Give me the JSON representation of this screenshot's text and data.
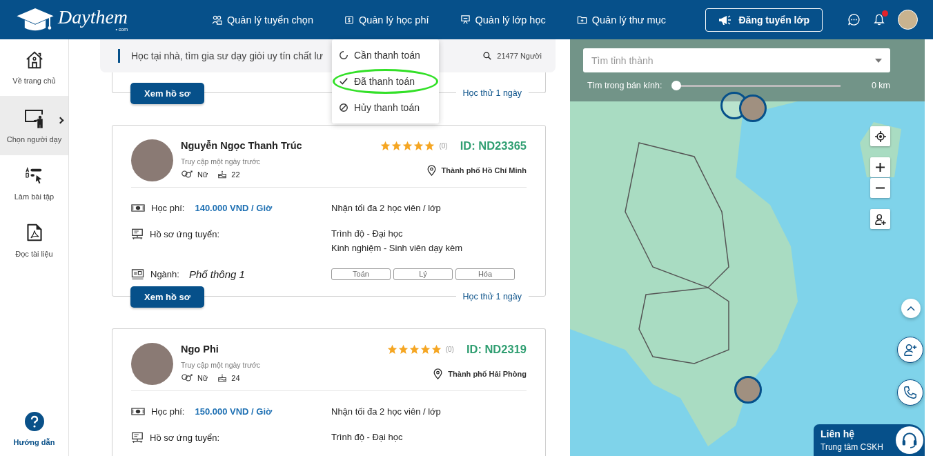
{
  "header": {
    "logo": "Daythem",
    "logo_sub": "• com",
    "nav": [
      {
        "label": "Quản lý tuyển chọn",
        "kind": "people"
      },
      {
        "label": "Quản lý học phí",
        "kind": "fee"
      },
      {
        "label": "Quản lý lớp học",
        "kind": "class"
      },
      {
        "label": "Quản lý thư mục",
        "kind": "folder"
      }
    ],
    "post_button": "Đăng tuyển lớp",
    "unread_notifications": true
  },
  "fee_menu": {
    "items": [
      {
        "label": "Cần thanh toán",
        "kind": "pending",
        "highlighted": false
      },
      {
        "label": "Đã thanh toán",
        "kind": "paid",
        "highlighted": true
      },
      {
        "label": "Hủy thanh toán",
        "kind": "cancelled",
        "highlighted": false
      }
    ]
  },
  "sidebar": {
    "items": [
      {
        "label": "Về trang chủ",
        "kind": "home",
        "selected": false
      },
      {
        "label": "Chọn người dạy",
        "kind": "teacher",
        "selected": true
      },
      {
        "label": "Làm bài tập",
        "kind": "exercise",
        "selected": false
      },
      {
        "label": "Đọc tài liệu",
        "kind": "pdf",
        "selected": false
      }
    ],
    "help": "Hướng dẫn"
  },
  "banner": {
    "text": "Học tại nhà, tìm gia sư dạy giỏi uy tín chất lư",
    "count": "21477 Người"
  },
  "tutors": [
    {
      "kind": "footer_only",
      "button": "Xem hồ sơ",
      "trial": "Học thử 1 ngày"
    },
    {
      "kind": "full",
      "name": "Nguyễn Ngọc Thanh Trúc",
      "last_seen": "Truy cập một ngày trước",
      "gender": "Nữ",
      "age": "22",
      "stars": 5,
      "reviews": "(0)",
      "id": "ID: ND23365",
      "location": "Thành phố Hồ Chí Minh",
      "fee_label": "Học phí:",
      "fee": "140.000 VND / Giờ",
      "capacity": "Nhận tối đa 2 học viên / lớp",
      "profile_label": "Hồ sơ ứng tuyển:",
      "profile_lines": [
        "Trình độ - Đại học",
        "Kinh nghiệm - Sinh viên dạy kèm"
      ],
      "major_label": "Ngành:",
      "major": "Phổ thông 1",
      "subjects": [
        "Toán",
        "Lý",
        "Hóa"
      ],
      "button": "Xem hồ sơ",
      "trial": "Học thử 1 ngày"
    },
    {
      "kind": "full",
      "name": "Ngo Phi",
      "last_seen": "Truy cập một ngày trước",
      "gender": "Nữ",
      "age": "24",
      "stars": 5,
      "reviews": "(0)",
      "id": "ID: ND2319",
      "location": "Thành phố Hải Phòng",
      "fee_label": "Học phí:",
      "fee": "150.000 VND / Giờ",
      "capacity": "Nhận tối đa 2 học viên / lớp",
      "profile_label": "Hồ sơ ứng tuyển:",
      "profile_lines": [
        "Trình độ - Đại học"
      ]
    }
  ],
  "map": {
    "search_placeholder": "Tìm tỉnh thành",
    "radius_label": "Tìm trong bán kính:",
    "radius_value": "0 km",
    "level": 0
  },
  "contact": {
    "title": "Liên hệ",
    "subtitle": "Trung tâm CSKH"
  }
}
